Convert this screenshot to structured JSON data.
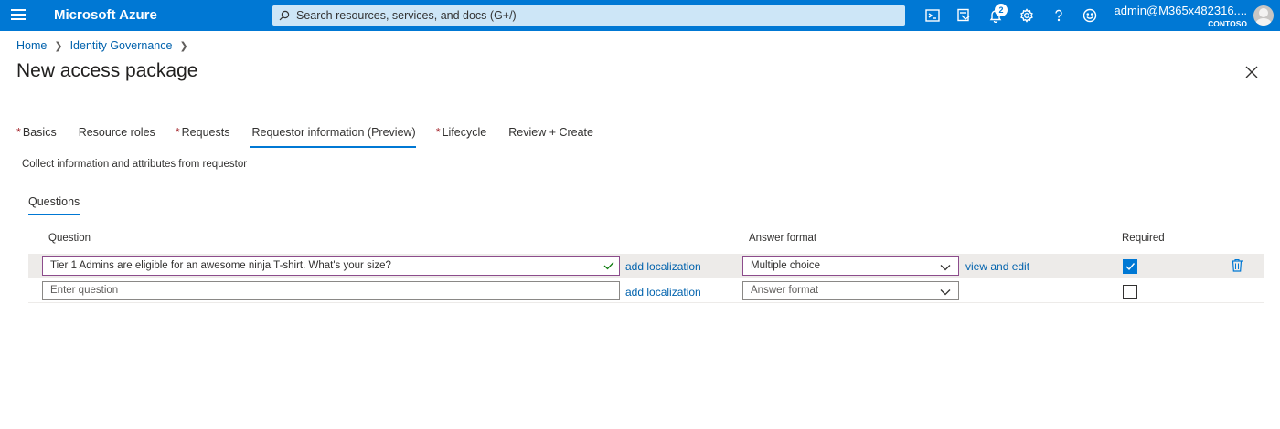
{
  "topbar": {
    "brand": "Microsoft Azure",
    "search_placeholder": "Search resources, services, and docs (G+/)",
    "notifications_count": "2",
    "user_name": "admin@M365x482316....",
    "user_org": "CONTOSO",
    "icons": [
      "menu-icon",
      "cloud-shell-icon",
      "directory-filter-icon",
      "notifications-icon",
      "settings-icon",
      "help-icon",
      "feedback-icon"
    ]
  },
  "breadcrumb": [
    "Home",
    "Identity Governance"
  ],
  "page_title": "New access package",
  "tabs": [
    {
      "label": "Basics",
      "required": "*"
    },
    {
      "label": "Resource roles",
      "required": ""
    },
    {
      "label": "Requests",
      "required": "*"
    },
    {
      "label": "Requestor information (Preview)",
      "required": "",
      "active": true
    },
    {
      "label": "Lifecycle",
      "required": "*"
    },
    {
      "label": "Review + Create",
      "required": ""
    }
  ],
  "subtitle": "Collect information and attributes from requestor",
  "subtab": "Questions",
  "table": {
    "headers": {
      "question": "Question",
      "answer_format": "Answer format",
      "required": "Required"
    },
    "rows": [
      {
        "question": "Tier 1 Admins are eligible for an awesome ninja T-shirt. What's your size?",
        "localization": "add localization",
        "answer_format": "Multiple choice",
        "edit_link": "view and edit",
        "required": true
      },
      {
        "question_placeholder": "Enter question",
        "localization": "add localization",
        "answer_format_placeholder": "Answer format",
        "required": false
      }
    ]
  },
  "colors": {
    "accent": "#0078d4",
    "link": "#0062ad",
    "required_star": "#a4262c",
    "focus_border": "#8c4c8c"
  }
}
